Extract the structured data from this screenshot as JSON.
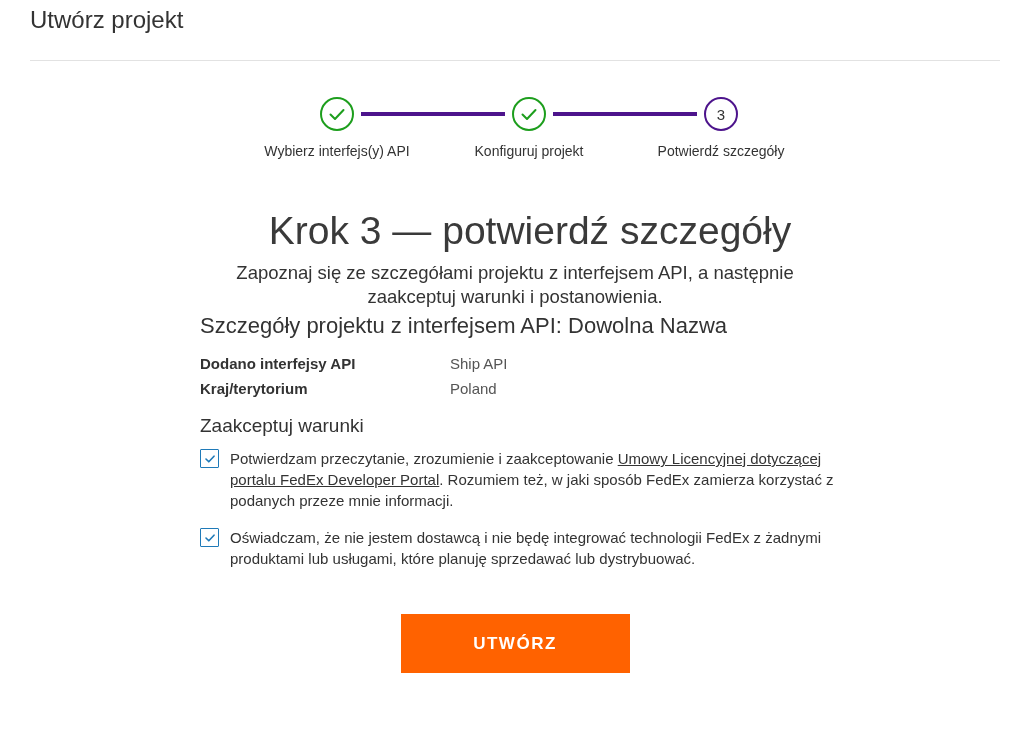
{
  "page": {
    "title": "Utwórz projekt"
  },
  "stepper": {
    "steps": [
      {
        "label": "Wybierz interfejs(y) API",
        "completed": true
      },
      {
        "label": "Konfiguruj projekt",
        "completed": true
      },
      {
        "label": "Potwierdź szczegóły",
        "completed": false,
        "number": "3"
      }
    ]
  },
  "heading": "Krok 3 — potwierdź szczegóły",
  "intro": "Zapoznaj się ze szczegółami projektu z interfejsem API, a następnie zaakceptuj warunki i postanowienia.",
  "details": {
    "title": "Szczegóły projektu z interfejsem API: Dowolna Nazwa",
    "rows": [
      {
        "label": "Dodano interfejsy API",
        "value": "Ship API"
      },
      {
        "label": "Kraj/terytorium",
        "value": "Poland"
      }
    ]
  },
  "terms": {
    "title": "Zaakceptuj warunki",
    "items": [
      {
        "checked": true,
        "parts": [
          {
            "kind": "text",
            "text": "Potwierdzam przeczytanie, zrozumienie i zaakceptowanie "
          },
          {
            "kind": "link",
            "text": "Umowy Licencyjnej dotyczącej"
          },
          {
            "kind": "link",
            "text": "portalu FedEx Developer Portal"
          },
          {
            "kind": "text",
            "text": ". Rozumiem też, w jaki sposób FedEx zamierza korzystać z podanych przeze mnie informacji."
          }
        ]
      },
      {
        "checked": true,
        "parts": [
          {
            "kind": "text",
            "text": "Oświadczam, że nie jestem dostawcą i nie będę integrować technologii FedEx z żadnymi produktami lub usługami, które planuję sprzedawać lub dystrybuować."
          }
        ]
      }
    ]
  },
  "create_button": {
    "label": "UTWÓRZ"
  }
}
